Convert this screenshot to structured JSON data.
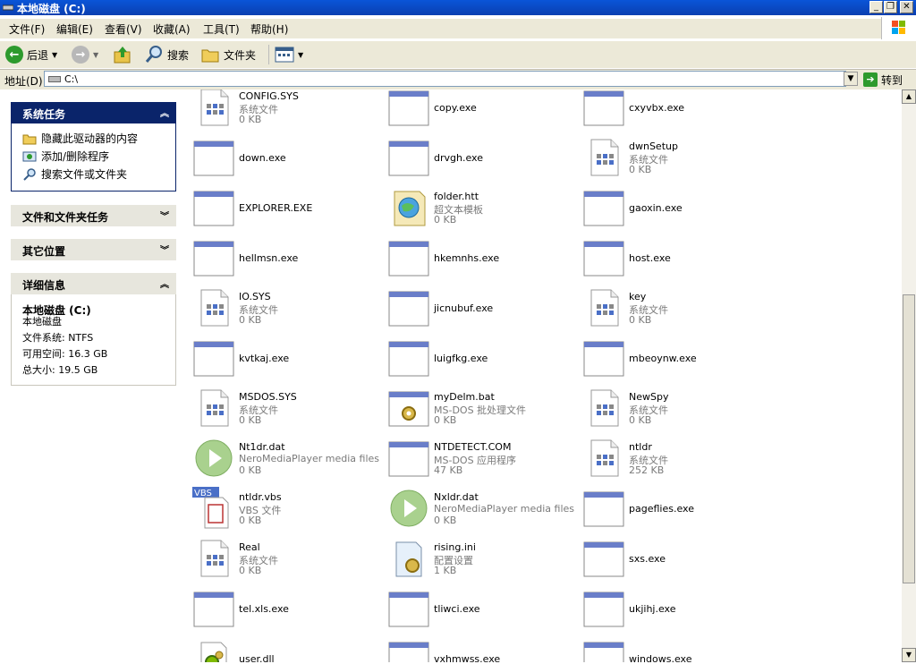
{
  "window": {
    "title": "本地磁盘 (C:)"
  },
  "menu": [
    "文件(F)",
    "编辑(E)",
    "查看(V)",
    "收藏(A)",
    "工具(T)",
    "帮助(H)"
  ],
  "toolbar": {
    "back": "后退",
    "search": "搜索",
    "folders": "文件夹"
  },
  "address": {
    "label": "地址(D)",
    "value": "C:\\",
    "go": "转到"
  },
  "sidebar": {
    "system_tasks": {
      "title": "系统任务",
      "items": [
        "隐藏此驱动器的内容",
        "添加/删除程序",
        "搜索文件或文件夹"
      ]
    },
    "file_tasks": {
      "title": "文件和文件夹任务"
    },
    "other_places": {
      "title": "其它位置"
    },
    "details": {
      "title": "详细信息",
      "name": "本地磁盘 (C:)",
      "type": "本地磁盘",
      "fs": "文件系统: NTFS",
      "free": "可用空间: 16.3 GB",
      "total": "总大小: 19.5 GB"
    }
  },
  "files": [
    {
      "name": "CONFIG.SYS",
      "type": "系统文件",
      "size": "0 KB",
      "icon": "sys"
    },
    {
      "name": "copy.exe",
      "type": "",
      "size": "",
      "icon": "exe"
    },
    {
      "name": "cxyvbx.exe",
      "type": "",
      "size": "",
      "icon": "exe"
    },
    {
      "name": "down.exe",
      "type": "",
      "size": "",
      "icon": "exe"
    },
    {
      "name": "drvgh.exe",
      "type": "",
      "size": "",
      "icon": "exe"
    },
    {
      "name": "dwnSetup",
      "type": "系统文件",
      "size": "0 KB",
      "icon": "sys"
    },
    {
      "name": "EXPLORER.EXE",
      "type": "",
      "size": "",
      "icon": "exe"
    },
    {
      "name": "folder.htt",
      "type": "超文本模板",
      "size": "0 KB",
      "icon": "htt"
    },
    {
      "name": "gaoxin.exe",
      "type": "",
      "size": "",
      "icon": "exe"
    },
    {
      "name": "hellmsn.exe",
      "type": "",
      "size": "",
      "icon": "exe"
    },
    {
      "name": "hkemnhs.exe",
      "type": "",
      "size": "",
      "icon": "exe"
    },
    {
      "name": "host.exe",
      "type": "",
      "size": "",
      "icon": "exe"
    },
    {
      "name": "IO.SYS",
      "type": "系统文件",
      "size": "0 KB",
      "icon": "sys"
    },
    {
      "name": "jicnubuf.exe",
      "type": "",
      "size": "",
      "icon": "exe"
    },
    {
      "name": "key",
      "type": "系统文件",
      "size": "0 KB",
      "icon": "sys"
    },
    {
      "name": "kvtkaj.exe",
      "type": "",
      "size": "",
      "icon": "exe"
    },
    {
      "name": "luigfkg.exe",
      "type": "",
      "size": "",
      "icon": "exe"
    },
    {
      "name": "mbeoynw.exe",
      "type": "",
      "size": "",
      "icon": "exe"
    },
    {
      "name": "MSDOS.SYS",
      "type": "系统文件",
      "size": "0 KB",
      "icon": "sys"
    },
    {
      "name": "myDelm.bat",
      "type": "MS-DOS 批处理文件",
      "size": "0 KB",
      "icon": "bat"
    },
    {
      "name": "NewSpy",
      "type": "系统文件",
      "size": "0 KB",
      "icon": "sys"
    },
    {
      "name": "Nt1dr.dat",
      "type": "NeroMediaPlayer media files",
      "size": "0 KB",
      "icon": "media"
    },
    {
      "name": "NTDETECT.COM",
      "type": "MS-DOS 应用程序",
      "size": "47 KB",
      "icon": "exe"
    },
    {
      "name": "ntldr",
      "type": "系统文件",
      "size": "252 KB",
      "icon": "sys"
    },
    {
      "name": "ntldr.vbs",
      "type": "VBS 文件",
      "size": "0 KB",
      "icon": "vbs"
    },
    {
      "name": "Nxldr.dat",
      "type": "NeroMediaPlayer media files",
      "size": "0 KB",
      "icon": "media"
    },
    {
      "name": "pageflies.exe",
      "type": "",
      "size": "",
      "icon": "exe"
    },
    {
      "name": "Real",
      "type": "系统文件",
      "size": "0 KB",
      "icon": "sys"
    },
    {
      "name": "rising.ini",
      "type": "配置设置",
      "size": "1 KB",
      "icon": "ini"
    },
    {
      "name": "sxs.exe",
      "type": "",
      "size": "",
      "icon": "exe"
    },
    {
      "name": "tel.xls.exe",
      "type": "",
      "size": "",
      "icon": "exe"
    },
    {
      "name": "tliwci.exe",
      "type": "",
      "size": "",
      "icon": "exe"
    },
    {
      "name": "ukjihj.exe",
      "type": "",
      "size": "",
      "icon": "exe"
    },
    {
      "name": "user.dll",
      "type": "",
      "size": "",
      "icon": "dll"
    },
    {
      "name": "vxhmwss.exe",
      "type": "",
      "size": "",
      "icon": "exe"
    },
    {
      "name": "windows.exe",
      "type": "",
      "size": "",
      "icon": "exe"
    }
  ],
  "icons": {
    "sys": "system-file-icon",
    "exe": "application-icon",
    "htt": "html-template-icon",
    "bat": "batch-file-icon",
    "media": "media-file-icon",
    "vbs": "vbs-script-icon",
    "ini": "config-file-icon",
    "dll": "dll-file-icon"
  },
  "colors": {
    "title_bar": "#0a55d8",
    "task_header": "#0a246a",
    "chrome": "#ece9d8"
  }
}
